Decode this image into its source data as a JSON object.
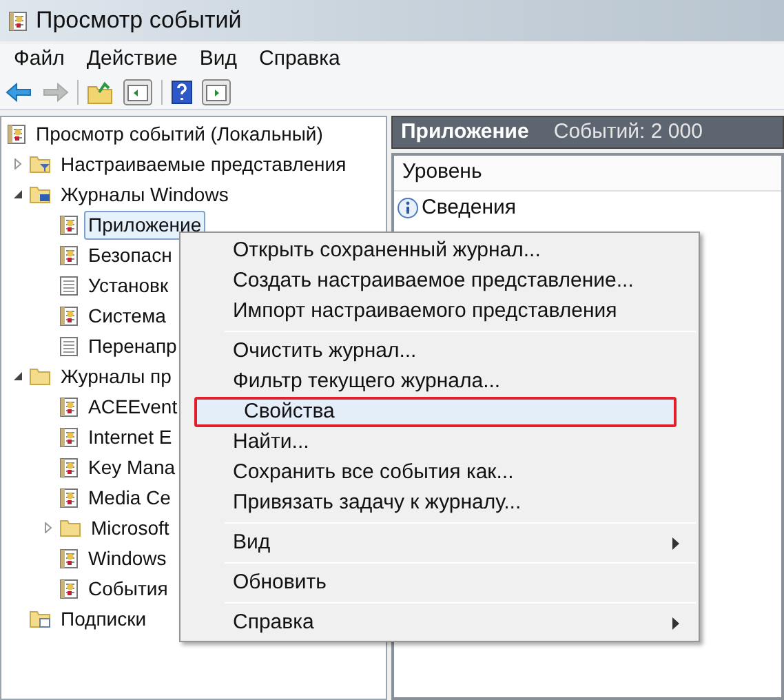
{
  "window": {
    "title": "Просмотр событий"
  },
  "menu_bar": [
    "Файл",
    "Действие",
    "Вид",
    "Справка"
  ],
  "toolbar": [
    {
      "kind": "back",
      "disabled": false
    },
    {
      "kind": "forward",
      "disabled": true
    },
    {
      "kind": "up",
      "disabled": false
    },
    {
      "kind": "tree-toggle",
      "disabled": false
    },
    {
      "kind": "help",
      "disabled": false
    },
    {
      "kind": "action-toggle",
      "disabled": false
    }
  ],
  "tree": [
    {
      "label": "Просмотр событий (Локальный)",
      "kind": "viewer",
      "selected": false,
      "children": [
        {
          "label": "Настраиваемые представления",
          "kind": "filter-folder",
          "expanded": false,
          "selected": false
        },
        {
          "label": "Журналы Windows",
          "kind": "windows-folder",
          "expanded": true,
          "selected": false,
          "children": [
            {
              "label": "Приложение",
              "kind": "log",
              "selected": true
            },
            {
              "label": "Безопасн",
              "kind": "log",
              "selected": false
            },
            {
              "label": "Установк",
              "kind": "plain-log",
              "selected": false
            },
            {
              "label": "Система",
              "kind": "log",
              "selected": false
            },
            {
              "label": "Перенапр",
              "kind": "plain-log",
              "selected": false
            }
          ]
        },
        {
          "label": "Журналы пр",
          "kind": "folder",
          "expanded": true,
          "selected": false,
          "children": [
            {
              "label": "ACEEvent",
              "kind": "log",
              "selected": false
            },
            {
              "label": "Internet E",
              "kind": "log",
              "selected": false
            },
            {
              "label": "Key Mana",
              "kind": "log",
              "selected": false
            },
            {
              "label": "Media Ce",
              "kind": "log",
              "selected": false
            },
            {
              "label": "Microsoft",
              "kind": "folder",
              "expanded": false,
              "selected": false
            },
            {
              "label": "Windows",
              "kind": "log",
              "selected": false
            },
            {
              "label": "События",
              "kind": "log",
              "selected": false
            }
          ]
        },
        {
          "label": "Подписки",
          "kind": "subscriptions",
          "selected": false
        }
      ]
    }
  ],
  "right_pane": {
    "title": "Приложение",
    "count": "Событий: 2 000",
    "columns": [
      "Уровень"
    ],
    "rows": [
      {
        "severity": "Сведения"
      }
    ]
  },
  "context_menu": {
    "groups": [
      [
        {
          "label": "Открыть сохраненный журнал...",
          "selected": false,
          "submenu": false
        },
        {
          "label": "Создать настраиваемое представление...",
          "selected": false,
          "submenu": false
        },
        {
          "label": "Импорт настраиваемого представления",
          "selected": false,
          "submenu": false
        }
      ],
      [
        {
          "label": "Очистить журнал...",
          "selected": false,
          "submenu": false
        },
        {
          "label": "Фильтр текущего журнала...",
          "selected": false,
          "submenu": false
        },
        {
          "label": "Свойства",
          "selected": true,
          "submenu": false
        },
        {
          "label": "Найти...",
          "selected": false,
          "submenu": false
        },
        {
          "label": "Сохранить все события как...",
          "selected": false,
          "submenu": false
        },
        {
          "label": "Привязать задачу к журналу...",
          "selected": false,
          "submenu": false
        }
      ],
      [
        {
          "label": "Вид",
          "selected": false,
          "submenu": true
        }
      ],
      [
        {
          "label": "Обновить",
          "selected": false,
          "submenu": false
        }
      ],
      [
        {
          "label": "Справка",
          "selected": false,
          "submenu": true
        }
      ]
    ]
  }
}
